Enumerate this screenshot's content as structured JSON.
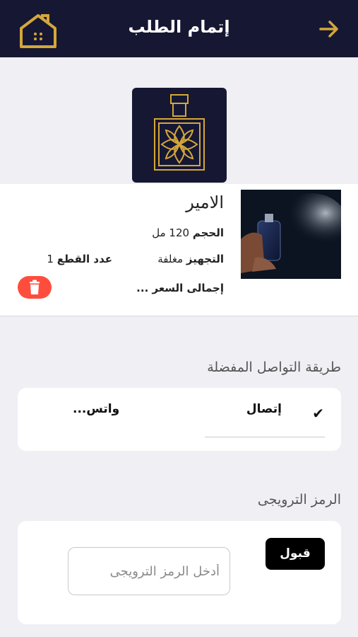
{
  "header": {
    "title": "إتمام الطلب",
    "home_icon": "home-icon",
    "back_icon": "arrow-right-icon"
  },
  "colors": {
    "navy": "#161733",
    "gold": "#d4a73a",
    "delete_red": "#ff4d3d"
  },
  "product": {
    "name": "الامير",
    "size_label": "الحجم",
    "size_value": "120 مل",
    "packaging_label": "التجهيز",
    "packaging_value": "مغلفة",
    "qty_label": "عدد القطع",
    "qty_value": "1",
    "total_label": "إجمالى السعر ...",
    "delete_icon": "trash-icon"
  },
  "contact": {
    "section_title": "طريقة التواصل المفضلة",
    "option_call": "إتصال",
    "option_whatsapp": "واتس...",
    "selected": "إتصال"
  },
  "promo": {
    "section_title": "الرمز الترويجى",
    "placeholder": "أدخل الرمز الترويجى",
    "accept_label": "قبول"
  }
}
